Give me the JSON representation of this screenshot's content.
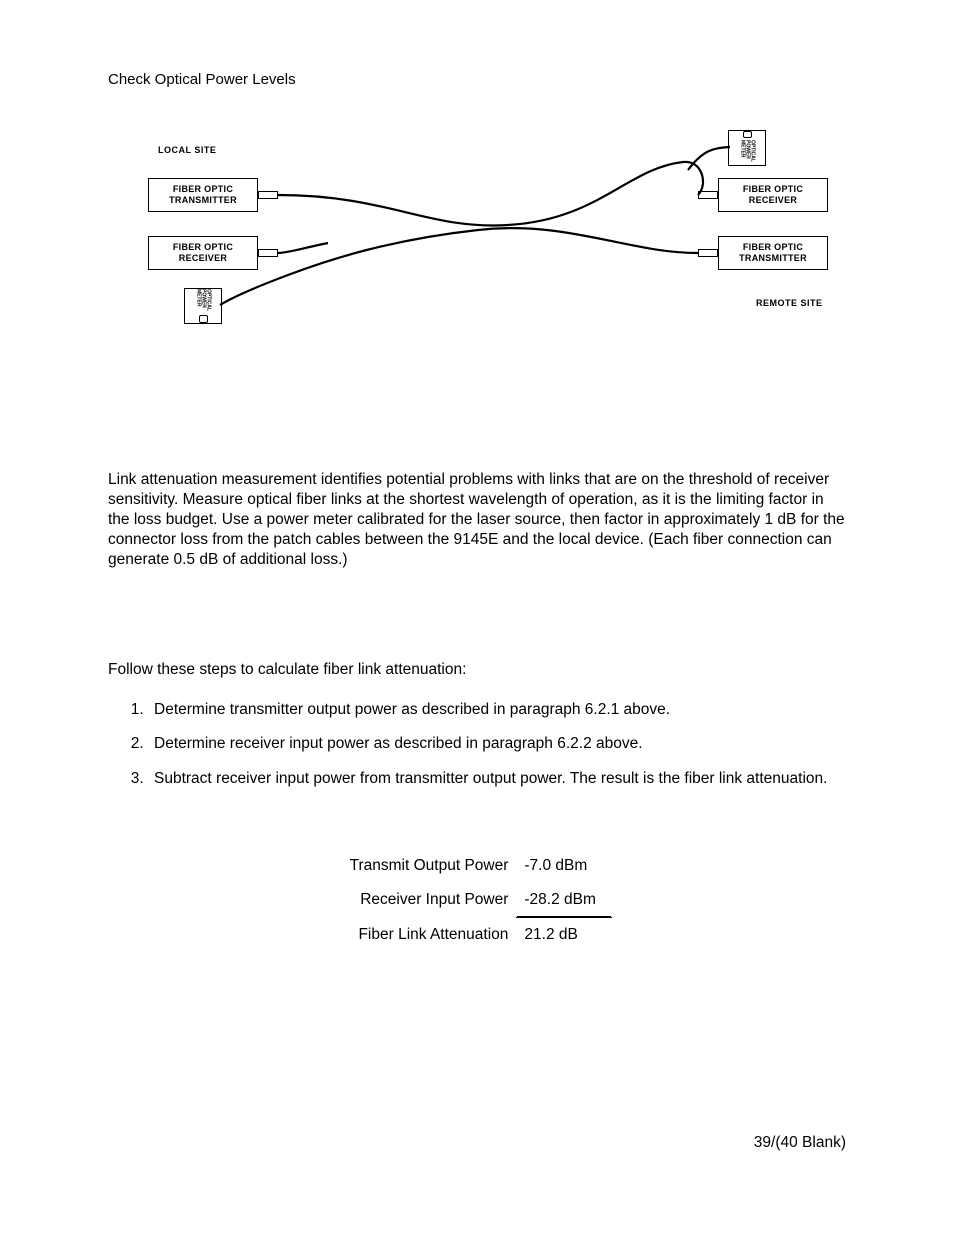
{
  "header": {
    "title": "Check Optical Power Levels"
  },
  "diagram": {
    "local_site": "LOCAL SITE",
    "remote_site": "REMOTE SITE",
    "fo_transmitter": "FIBER OPTIC TRANSMITTER",
    "fo_receiver": "FIBER OPTIC RECEIVER",
    "meter": "OPTICAL POWER METER"
  },
  "body": {
    "para1": "Link attenuation measurement identifies potential problems with links that are on the threshold of receiver sensitivity. Measure optical fiber links at the shortest wavelength of operation, as it is the limiting factor in the loss budget. Use a power meter calibrated for the laser source, then factor in approximately 1 dB for the connector loss from the patch cables between the 9145E and the local device. (Each fiber connection can generate 0.5 dB of additional loss.)",
    "para2": "Follow these steps to calculate fiber link attenuation:",
    "steps": [
      "Determine transmitter output power as described in paragraph 6.2.1 above.",
      "Determine receiver input power as described in paragraph 6.2.2 above.",
      "Subtract receiver input power from transmitter output power. The result is the fiber link attenuation."
    ]
  },
  "calc": {
    "rows": [
      {
        "label": "Transmit Output Power",
        "value": "-7.0 dBm"
      },
      {
        "label": "Receiver Input Power",
        "value": "-28.2 dBm"
      },
      {
        "label": "Fiber Link Attenuation",
        "value": "21.2 dB"
      }
    ]
  },
  "footer": {
    "page": "39/(40 Blank)"
  }
}
